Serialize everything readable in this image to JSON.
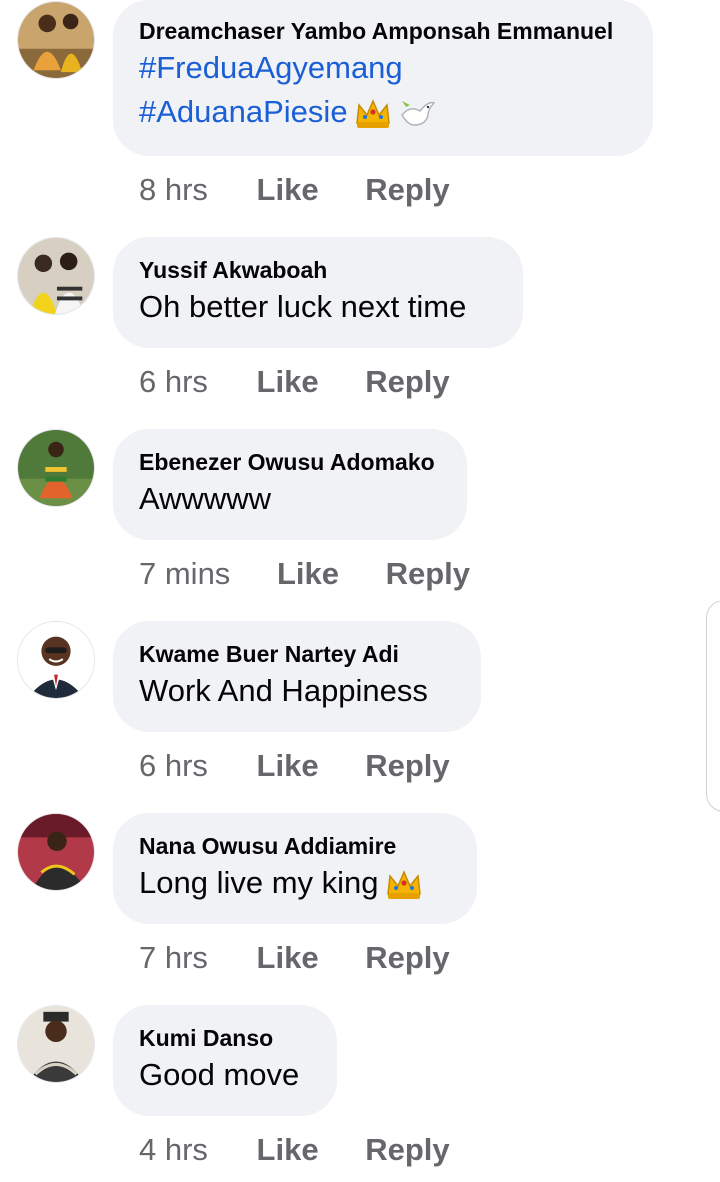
{
  "comments": [
    {
      "author": "Dreamchaser Yambo Amponsah Emmanuel",
      "lines": [
        "#FreduaAgyemang",
        "#AduanaPiesie"
      ],
      "emojis": [
        "crown-emoji",
        "dove-emoji"
      ],
      "time": "8 hrs",
      "like": "Like",
      "reply": "Reply"
    },
    {
      "author": "Yussif Akwaboah",
      "text": "Oh better luck next time",
      "time": "6 hrs",
      "like": "Like",
      "reply": "Reply"
    },
    {
      "author": "Ebenezer Owusu Adomako",
      "text": "Awwwww",
      "time": "7 mins",
      "like": "Like",
      "reply": "Reply"
    },
    {
      "author": "Kwame Buer Nartey Adi",
      "text": "Work And Happiness",
      "time": "6 hrs",
      "like": "Like",
      "reply": "Reply"
    },
    {
      "author": "Nana Owusu Addiamire",
      "text": "Long live my king",
      "emojis": [
        "crown-emoji"
      ],
      "time": "7 hrs",
      "like": "Like",
      "reply": "Reply"
    },
    {
      "author": "Kumi Danso",
      "text": "Good move",
      "time": "4 hrs",
      "like": "Like",
      "reply": "Reply"
    }
  ],
  "colors": {
    "bubble": "#f0f2f5",
    "hashtag": "#1a5fd6",
    "meta": "#65676b",
    "text": "#050505"
  }
}
